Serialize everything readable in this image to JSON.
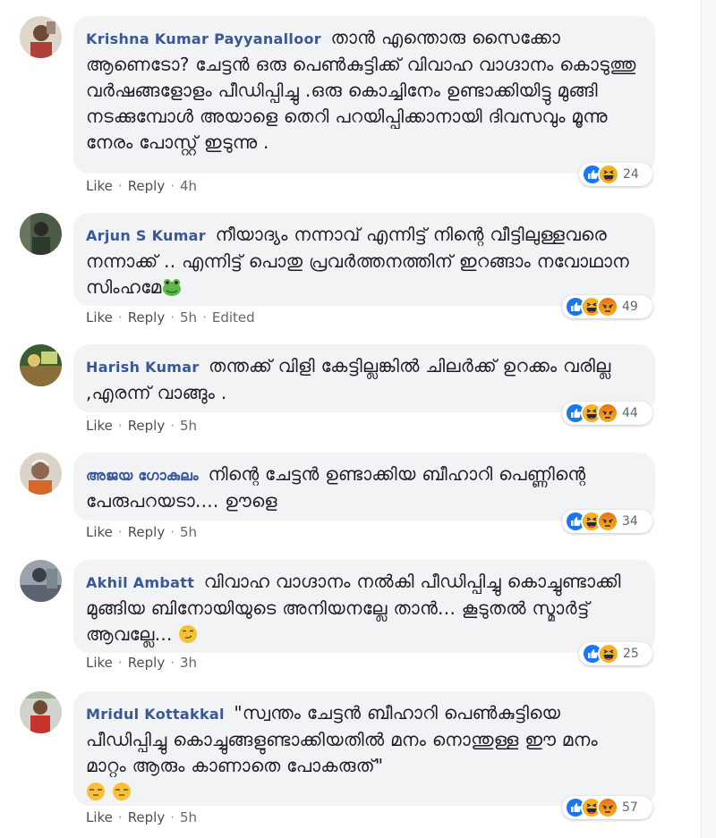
{
  "comments": [
    {
      "author": "Krishna Kumar Payyanalloor",
      "text": " താൻ എന്തൊരു സൈക്കോ ആണെടോ? ചേട്ടൻ ഒരു പെൺകുട്ടിക്ക് വിവാഹ വാഗ്ദാനം കൊടുത്തു വർഷങ്ങളോളം പീഡിപ്പിച്ചു .ഒരു കൊച്ചിനേം ഉണ്ടാക്കിയിട്ടു മുങ്ങി നടക്കുമ്പോൾ അയാളെ തെറി പറയിപ്പിക്കാനായി ദിവസവും മൂന്നു നേരം പോസ്റ്റ് ഇടുന്നു .",
      "like": "Like",
      "reply": "Reply",
      "time": "4h",
      "edited": "",
      "reactions": [
        "like",
        "haha"
      ],
      "count": "24"
    },
    {
      "author": "Arjun S Kumar",
      "text": " നീയാദ്യം നന്നാവ് എന്നിട്ട് നിന്റെ വീട്ടിലുള്ളവരെ നന്നാക്ക് .. എന്നിട്ട് പൊതു പ്രവർത്തനത്തിന് ഇറങ്ങാം നവോഥാന സിംഹമേ",
      "emoji": "frog",
      "like": "Like",
      "reply": "Reply",
      "time": "5h",
      "edited": "Edited",
      "reactions": [
        "like",
        "haha",
        "angry"
      ],
      "count": "49"
    },
    {
      "author": "Harish Kumar",
      "text": " തന്തക്ക് വിളി കേട്ടില്ലങ്കിൽ ചിലർക്ക് ഉറക്കം വരില്ല ,എരന്ന് വാങ്ങും .",
      "like": "Like",
      "reply": "Reply",
      "time": "5h",
      "edited": "",
      "reactions": [
        "like",
        "haha",
        "angry"
      ],
      "count": "44"
    },
    {
      "author": "അജയ ഗോകുലം",
      "text": " നിന്റെ ചേട്ടൻ ഉണ്ടാക്കിയ ബീഹാറി പെണ്ണിന്റെ പേരുപറയടാ.... ഊളെ",
      "like": "Like",
      "reply": "Reply",
      "time": "5h",
      "edited": "",
      "reactions": [
        "like",
        "haha",
        "angry"
      ],
      "count": "34"
    },
    {
      "author": "Akhil Ambatt",
      "text": " വിവാഹ വാഗ്ദാനം നൽകി പീഡിപ്പിച്ചു കൊച്ചുണ്ടാക്കി മുങ്ങിയ ബിനോയിയുടെ അനിയനല്ലേ താൻ... കൂടുതൽ സ്മാർട്ട് ആവല്ലേ...",
      "emoji": "smirk",
      "like": "Like",
      "reply": "Reply",
      "time": "3h",
      "edited": "",
      "reactions": [
        "like",
        "haha"
      ],
      "count": "25"
    },
    {
      "author": "Mridul Kottakkal",
      "text": " \"സ്വന്തം ചേട്ടൻ ബീഹാറി പെൺകുട്ടിയെ പീഡിപ്പിച്ചു കൊച്ചുങ്ങളുണ്ടാക്കിയതിൽ മനം നൊന്തുള്ള ഈ മനം മാറ്റം ആരും കാണാതെ പോകരുത്\"",
      "emoji": "unamused-pair",
      "like": "Like",
      "reply": "Reply",
      "time": "5h",
      "edited": "",
      "reactions": [
        "like",
        "haha",
        "angry"
      ],
      "count": "57"
    }
  ],
  "colors": {
    "author": "#385898",
    "bubble": "#f2f3f5",
    "like": "#1877f2",
    "haha": "#f7b125",
    "angry": "#e9710f"
  }
}
